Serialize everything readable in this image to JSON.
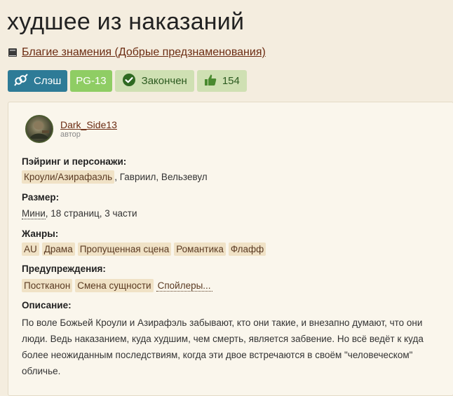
{
  "title": "худшее из наказаний",
  "fandom": {
    "link": "Благие знамения (Добрые предзнаменования)",
    "icon": "book-icon"
  },
  "badges": {
    "slash": "Слэш",
    "rating": "PG-13",
    "status": "Закончен",
    "likes": "154"
  },
  "author": {
    "name": "Dark_Side13",
    "role": "автор"
  },
  "pairing": {
    "label": "Пэйринг и персонажи:",
    "main": "Кроули/Азирафаэль",
    "rest": ", Гавриил, Вельзевул"
  },
  "size": {
    "label": "Размер:",
    "value": "Мини",
    "rest": ", 18 страниц, 3 части"
  },
  "genres": {
    "label": "Жанры:",
    "items": [
      "AU",
      "Драма",
      "Пропущенная сцена",
      "Романтика",
      "Флафф"
    ]
  },
  "warnings": {
    "label": "Предупреждения:",
    "items": [
      "Постканон",
      "Смена сущности"
    ],
    "more": "Спойлеры..."
  },
  "description": {
    "label": "Описание:",
    "text": "По воле Божьей Кроули и Азирафэль забывают, кто они такие, и внезапно думают, что они люди. Ведь наказанием, куда худшим, чем смерть, является забвение. Но всё ведёт к куда более неожиданным последствиям, когда эти двое встречаются в своём \"человеческом\" обличье."
  },
  "colors": {
    "background": "#f4eddf",
    "link": "#6b2c12",
    "slash_badge": "#2e7b97",
    "rating_badge": "#8fcd64",
    "status_badge": "#cfe0b3"
  }
}
